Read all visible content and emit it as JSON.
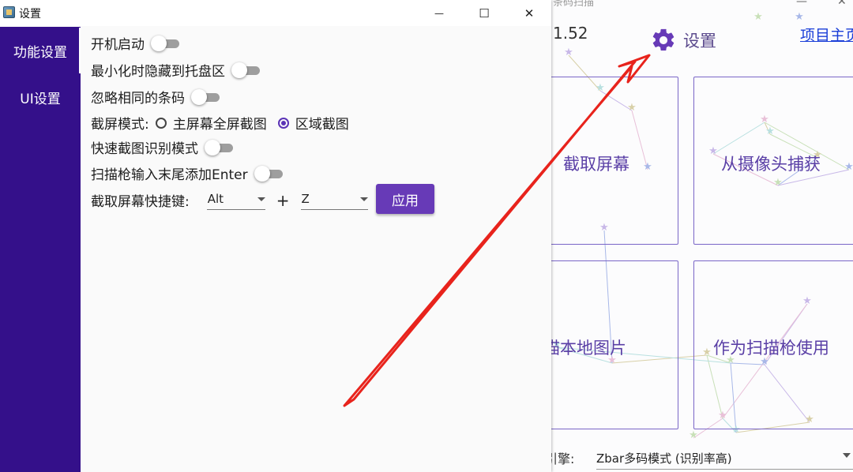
{
  "dialog": {
    "title": "设置",
    "window_buttons": {
      "minimize": "—",
      "maximize": "☐",
      "close": "✕"
    },
    "sidebar": {
      "items": [
        {
          "label": "功能设置",
          "active": true
        },
        {
          "label": "UI设置",
          "active": false
        }
      ]
    },
    "settings": {
      "autostart": {
        "label": "开机启动",
        "on": false
      },
      "minimize_to_tray": {
        "label": "最小化时隐藏到托盘区",
        "on": false
      },
      "ignore_same": {
        "label": "忽略相同的条码",
        "on": false
      },
      "screenshot_mode": {
        "label": "截屏模式:",
        "options": [
          {
            "label": "主屏幕全屏截图",
            "selected": false
          },
          {
            "label": "区域截图",
            "selected": true
          }
        ]
      },
      "quick_recognize": {
        "label": "快速截图识别模式",
        "on": false
      },
      "scanner_enter": {
        "label": "扫描枪输入末尾添加Enter",
        "on": false
      },
      "hotkey": {
        "label": "截取屏幕快捷键:",
        "modifier": "Alt",
        "plus": "+",
        "key": "Z",
        "apply_label": "应用"
      }
    }
  },
  "main_window": {
    "title_fragment": "条码扫描",
    "version": "1.52",
    "settings_label": "设置",
    "project_link": "项目主页",
    "tiles": [
      "截取屏幕",
      "从摄像头捕获",
      "扫描本地图片",
      "作为扫描枪使用"
    ],
    "engine_label": "引擎:",
    "engine_value": "Zbar多码模式 (识别率高)"
  },
  "colors": {
    "sidebar": "#34108a",
    "accent": "#673ab7",
    "tile_border": "#7a66c7",
    "tile_text": "#5a3fa6",
    "arrow": "#e8231c",
    "link": "#1a3ed8"
  },
  "icons": [
    "app-icon",
    "gear-icon",
    "chevron-down-icon",
    "star-icon"
  ]
}
